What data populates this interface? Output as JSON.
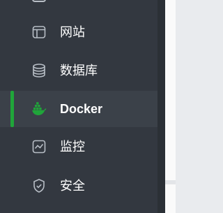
{
  "sidebar": {
    "items": [
      {
        "label": "网站",
        "icon": "website-icon",
        "active": false
      },
      {
        "label": "数据库",
        "icon": "database-icon",
        "active": false
      },
      {
        "label": "Docker",
        "icon": "docker-icon",
        "active": true
      },
      {
        "label": "监控",
        "icon": "monitor-icon",
        "active": false
      },
      {
        "label": "安全",
        "icon": "security-shield-icon",
        "active": false
      }
    ]
  },
  "colors": {
    "sidebar_bg": "#333840",
    "active_item_bg": "#3b4149",
    "accent": "#20a53a",
    "text": "#ffffff",
    "icon_stroke": "#b8bec6"
  }
}
